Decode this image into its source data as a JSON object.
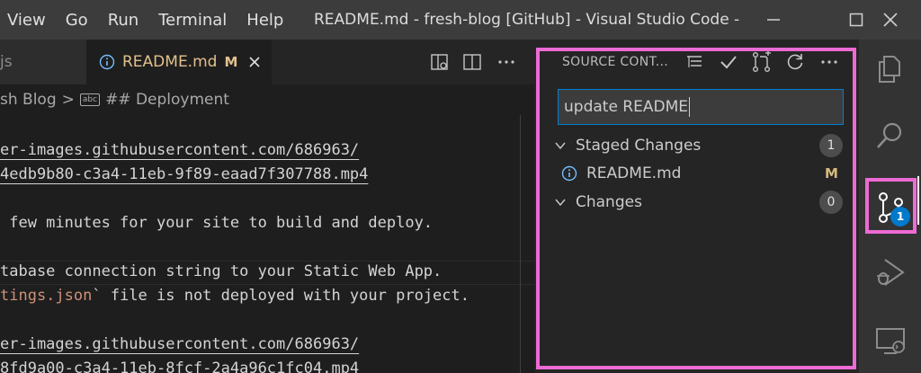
{
  "menu": [
    "View",
    "Go",
    "Run",
    "Terminal",
    "Help"
  ],
  "window_title": "README.md - fresh-blog [GitHub] - Visual Studio Code - Insiders",
  "tabs": {
    "inactive_label": "js",
    "active_label": "README.md",
    "active_status": "M"
  },
  "breadcrumb": {
    "parent": "sh Blog",
    "separator": ">",
    "symbol_badge": "abc",
    "current": "## Deployment"
  },
  "editor_lines": [
    "er-images.githubusercontent.com/686963/",
    "4edb9b80-c3a4-11eb-9f89-eaad7f307788.mp4",
    "",
    " few minutes for your site to build and deploy.",
    "",
    "tabase connection string to your Static Web App.",
    "tings.json",
    "` file is not deployed with your project.",
    "",
    "er-images.githubusercontent.com/686963/",
    "8fd9a00-c3a4-11eb-8fcf-2a4a96c1fc04.mp4"
  ],
  "scm": {
    "title": "SOURCE CONT...",
    "commit_message": "update README",
    "staged_label": "Staged Changes",
    "staged_count": "1",
    "staged_file": "README.md",
    "staged_file_status": "M",
    "changes_label": "Changes",
    "changes_count": "0"
  },
  "activity": {
    "scm_badge": "1"
  },
  "colors": {
    "highlight": "#ee6ad4",
    "modified": "#e2c08d",
    "accent": "#007acc"
  }
}
